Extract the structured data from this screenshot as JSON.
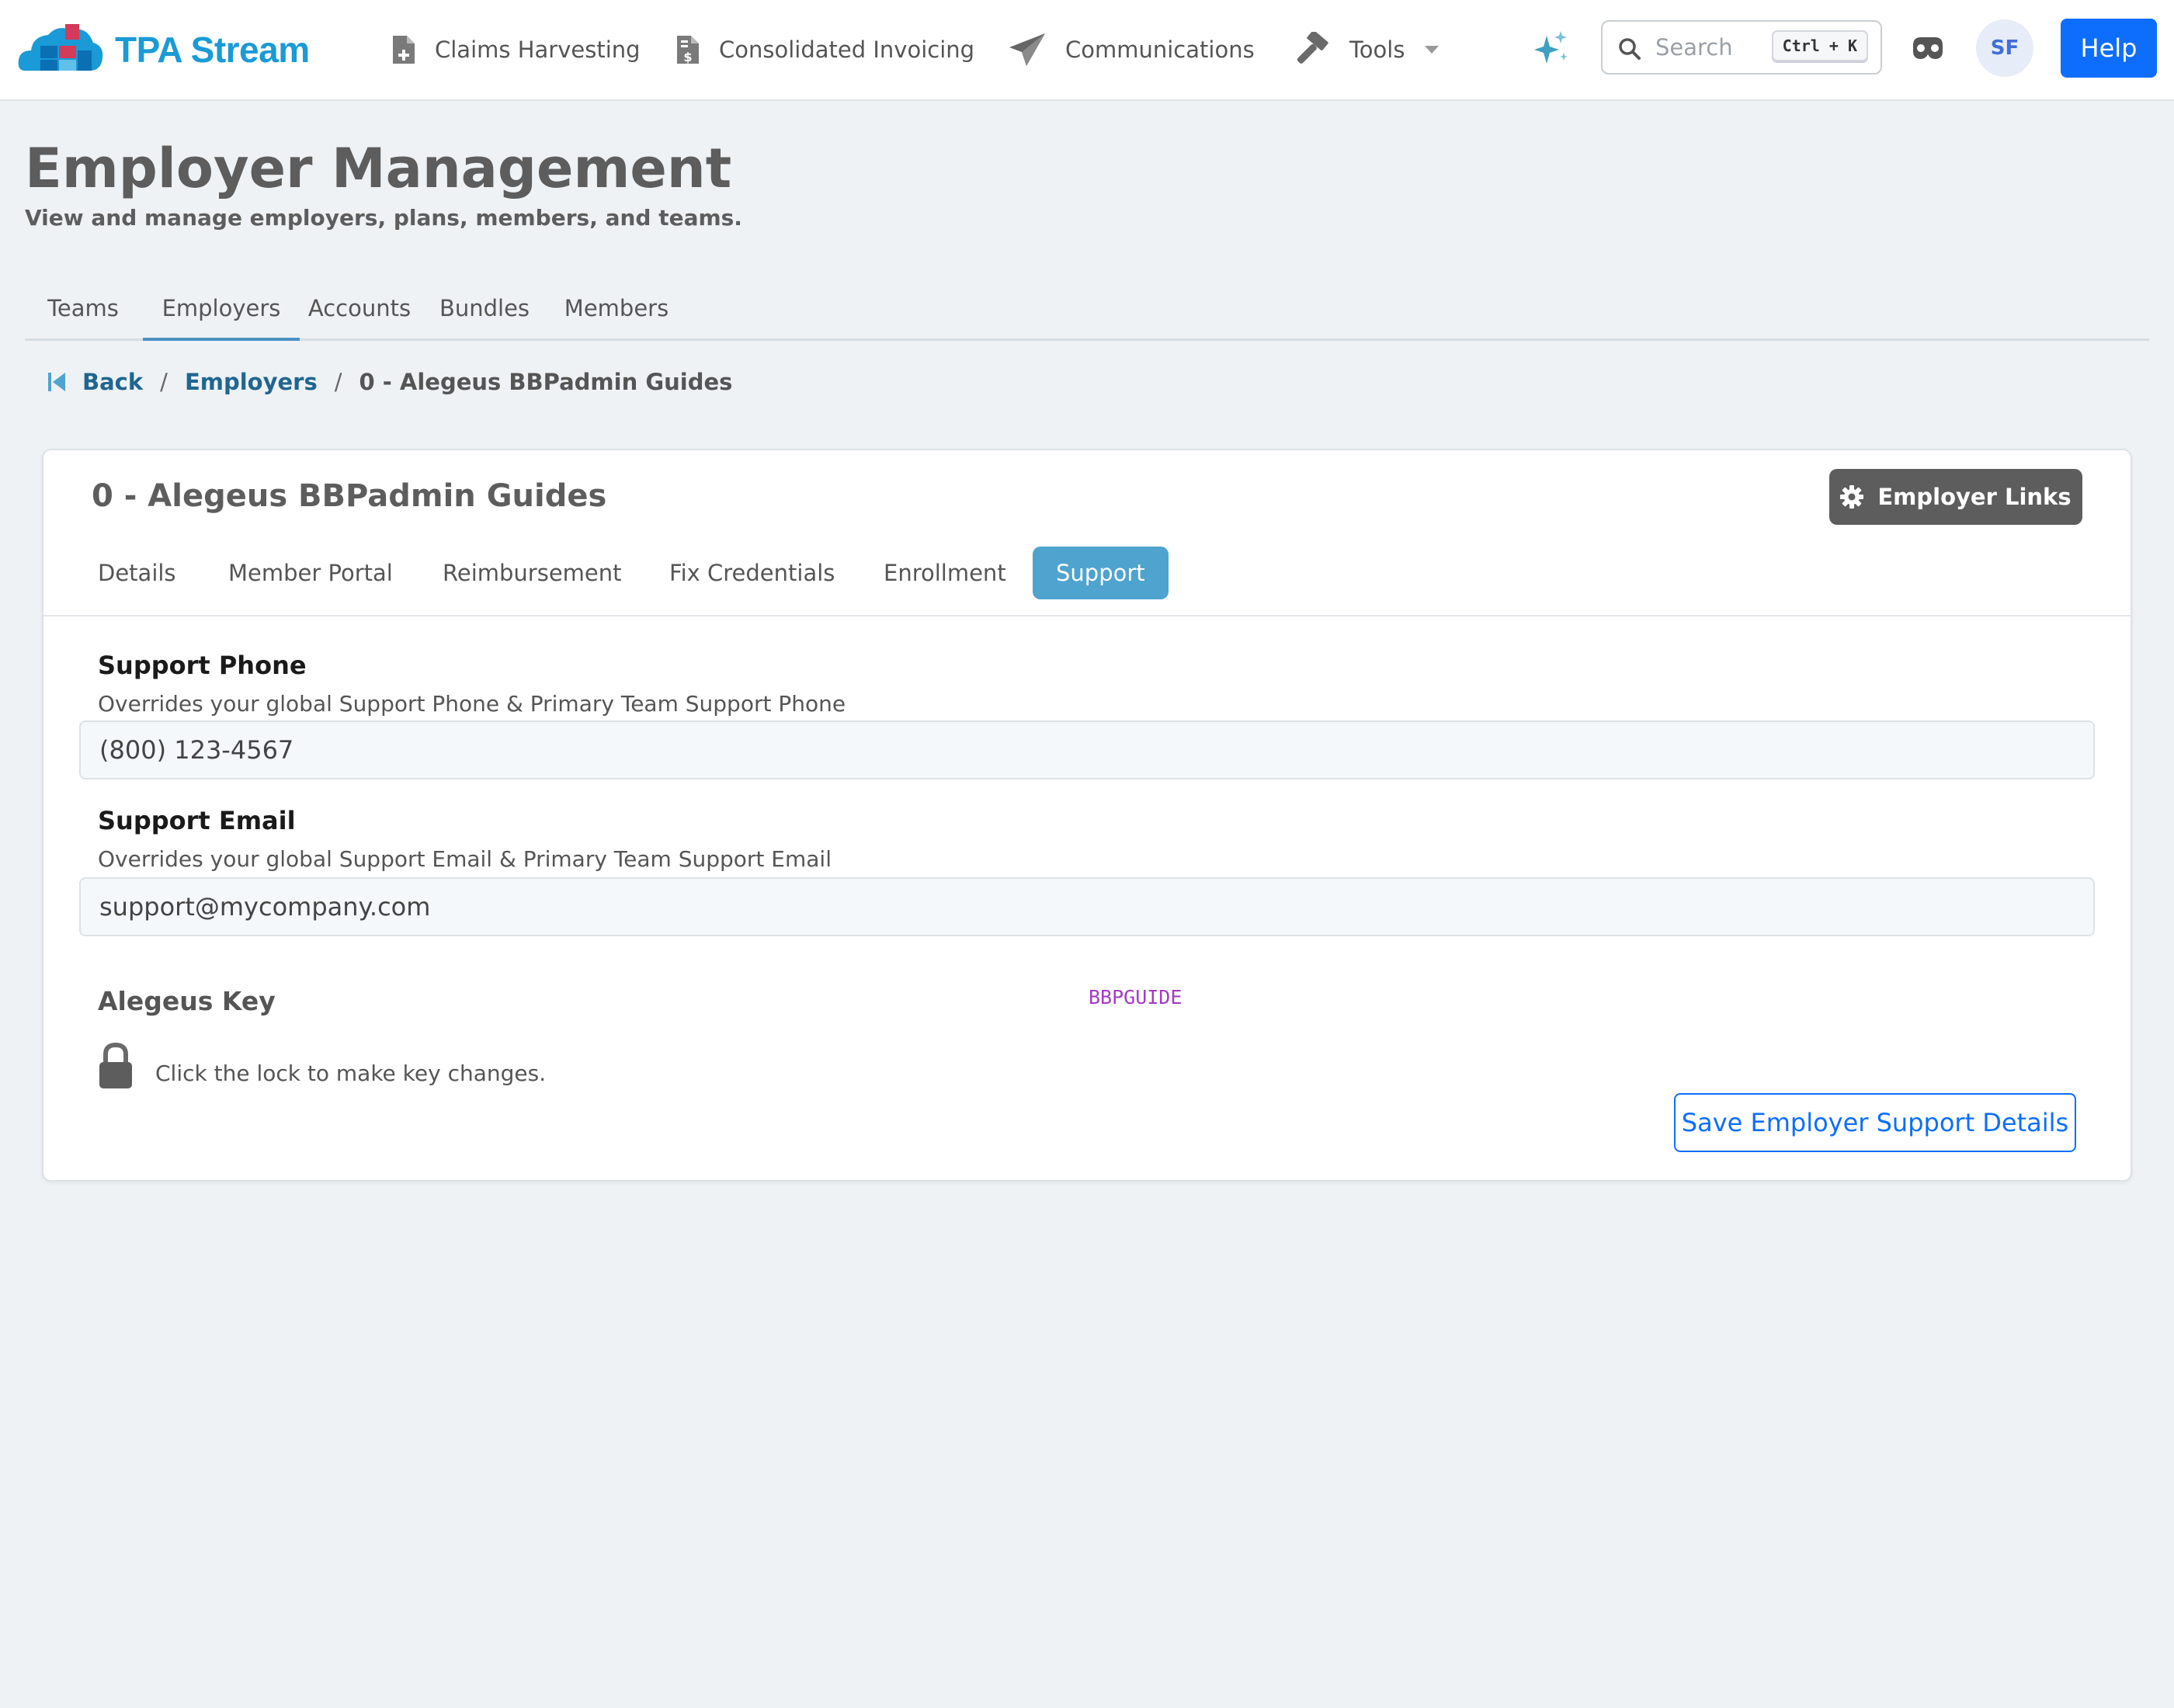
{
  "brand": {
    "name": "TPA Stream"
  },
  "nav": {
    "items": [
      {
        "label": "Claims Harvesting",
        "icon": "file-plus-icon"
      },
      {
        "label": "Consolidated Invoicing",
        "icon": "file-invoice-dollar-icon"
      },
      {
        "label": "Communications",
        "icon": "paper-plane-icon"
      },
      {
        "label": "Tools",
        "icon": "hammer-icon"
      }
    ],
    "search_placeholder": "Search",
    "search_shortcut": "Ctrl + K",
    "avatar_initials": "SF",
    "help_label": "Help"
  },
  "page": {
    "title": "Employer Management",
    "subtitle": "View and manage employers, plans, members, and teams."
  },
  "main_tabs": [
    "Teams",
    "Employers",
    "Accounts",
    "Bundles",
    "Members"
  ],
  "main_tabs_active": "Employers",
  "breadcrumb": {
    "back": "Back",
    "employers": "Employers",
    "current": "0 - Alegeus BBPadmin Guides"
  },
  "card": {
    "title": "0 - Alegeus BBPadmin Guides",
    "employer_links_label": "Employer Links",
    "tabs": [
      "Details",
      "Member Portal",
      "Reimbursement",
      "Fix Credentials",
      "Enrollment",
      "Support"
    ],
    "active_tab": "Support"
  },
  "support": {
    "phone_label": "Support Phone",
    "phone_help": "Overrides your global Support Phone & Primary Team Support Phone",
    "phone_value": "(800) 123-4567",
    "email_label": "Support Email",
    "email_help": "Overrides your global Support Email & Primary Team Support Email",
    "email_value": "support@mycompany.com",
    "key_label": "Alegeus Key",
    "key_value": "BBPGUIDE",
    "lock_text": "Click the lock to make key changes.",
    "save_label": "Save Employer Support Details"
  },
  "colors": {
    "brand_blue": "#1a9ad6",
    "primary": "#0d6efd",
    "active_subtab": "#4fa3cf",
    "key_value": "#a43bc3",
    "page_bg": "#eef2f5"
  }
}
